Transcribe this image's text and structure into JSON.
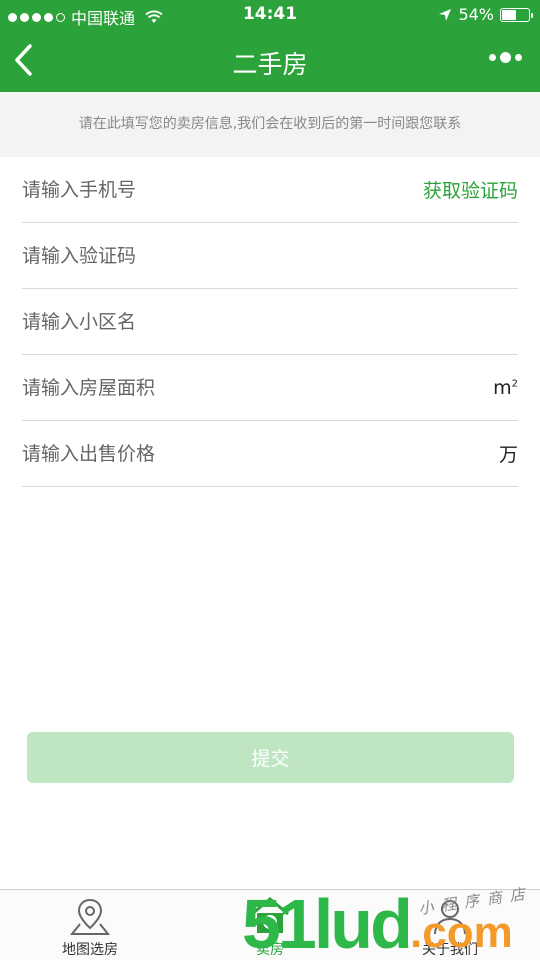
{
  "status_bar": {
    "carrier": "中国联通",
    "time": "14:41",
    "battery": "54%",
    "battery_level": 0.54
  },
  "nav": {
    "title": "二手房"
  },
  "notice": "请在此填写您的卖房信息,我们会在收到后的第一时间跟您联系",
  "form": {
    "phone_placeholder": "请输入手机号",
    "get_code_label": "获取验证码",
    "code_placeholder": "请输入验证码",
    "community_placeholder": "请输入小区名",
    "area_placeholder": "请输入房屋面积",
    "area_unit": "m",
    "area_unit_sup": "2",
    "price_placeholder": "请输入出售价格",
    "price_unit": "万"
  },
  "submit_label": "提交",
  "tabs": [
    {
      "label": "地图选房",
      "icon": "map-pin-icon"
    },
    {
      "label": "卖房",
      "icon": "house-yuan-icon"
    },
    {
      "label": "关于我们",
      "icon": "user-icon"
    }
  ],
  "watermark": {
    "main": "51lud",
    "com": ".com",
    "small": "小程序商店"
  },
  "colors": {
    "brand_green": "#2ba33a",
    "submit_disabled": "#bfe5c3",
    "notice_bg": "#f3f3f3"
  }
}
